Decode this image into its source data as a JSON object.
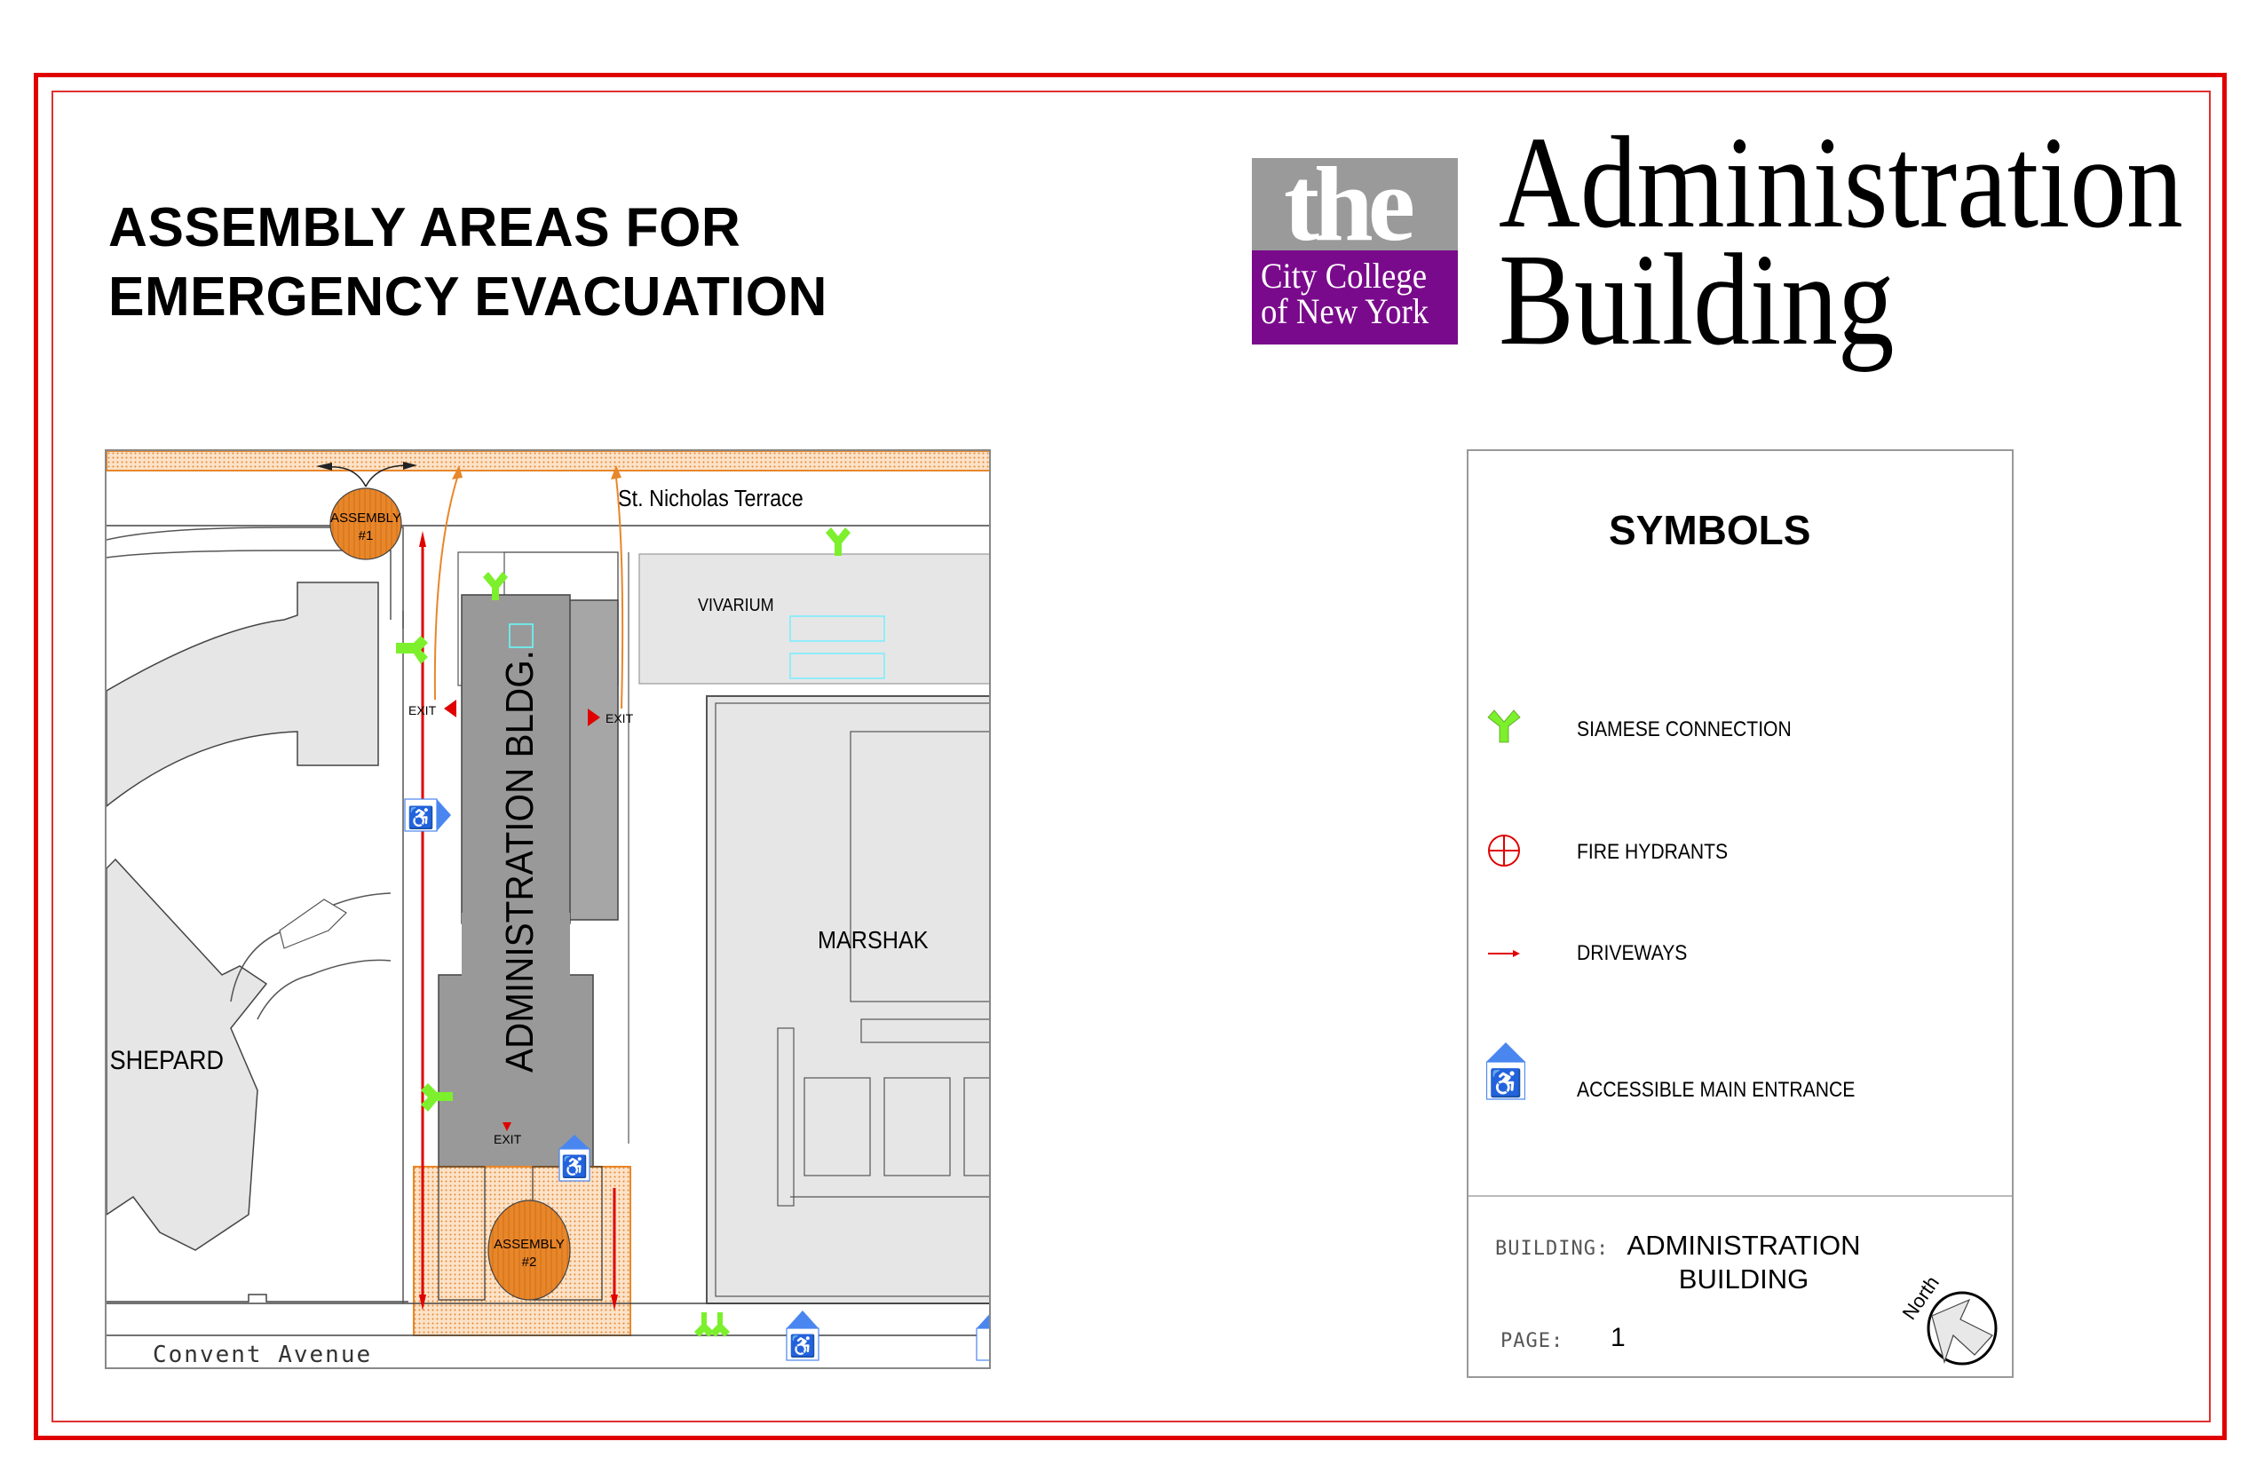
{
  "page": {
    "title_lines": [
      "ASSEMBLY AREAS FOR",
      "EMERGENCY EVACUATION"
    ],
    "building_heading_lines": [
      "Administration",
      "Building"
    ],
    "logo": {
      "word": "the",
      "line1": "City College",
      "line2": "of New York",
      "colors": {
        "top": "#9a9a9a",
        "bottom": "#7a0a8c"
      }
    },
    "frame_color": "#e00000"
  },
  "map": {
    "streets": {
      "north": "St. Nicholas Terrace",
      "south": "Convent Avenue"
    },
    "buildings": {
      "main": "ADMINISTRATION BLDG.",
      "vivarium": "VIVARIUM",
      "marshak": "MARSHAK",
      "shepard": "SHEPARD"
    },
    "assembly_areas": [
      {
        "label": "ASSEMBLY",
        "number": "#1"
      },
      {
        "label": "ASSEMBLY",
        "number": "#2"
      }
    ],
    "exits": [
      "EXIT",
      "EXIT",
      "EXIT"
    ],
    "colors": {
      "assembly": "#e8862a",
      "siamese": "#7cf02c",
      "exit": "#e00000",
      "driveway": "#e00000",
      "accessible": "#4a86f0",
      "building_main": "#999999",
      "building_other": "#e6e6e6"
    }
  },
  "legend": {
    "heading": "SYMBOLS",
    "items": [
      {
        "icon": "siamese-connection-icon",
        "label": "SIAMESE CONNECTION"
      },
      {
        "icon": "fire-hydrant-icon",
        "label": "FIRE HYDRANTS"
      },
      {
        "icon": "driveway-arrow-icon",
        "label": "DRIVEWAYS"
      },
      {
        "icon": "accessible-entrance-icon",
        "label": "ACCESSIBLE MAIN ENTRANCE"
      }
    ],
    "building_key": "BUILDING:",
    "building_value_lines": [
      "ADMINISTRATION",
      "BUILDING"
    ],
    "page_key": "PAGE:",
    "page_value": "1",
    "north_label": "North"
  }
}
